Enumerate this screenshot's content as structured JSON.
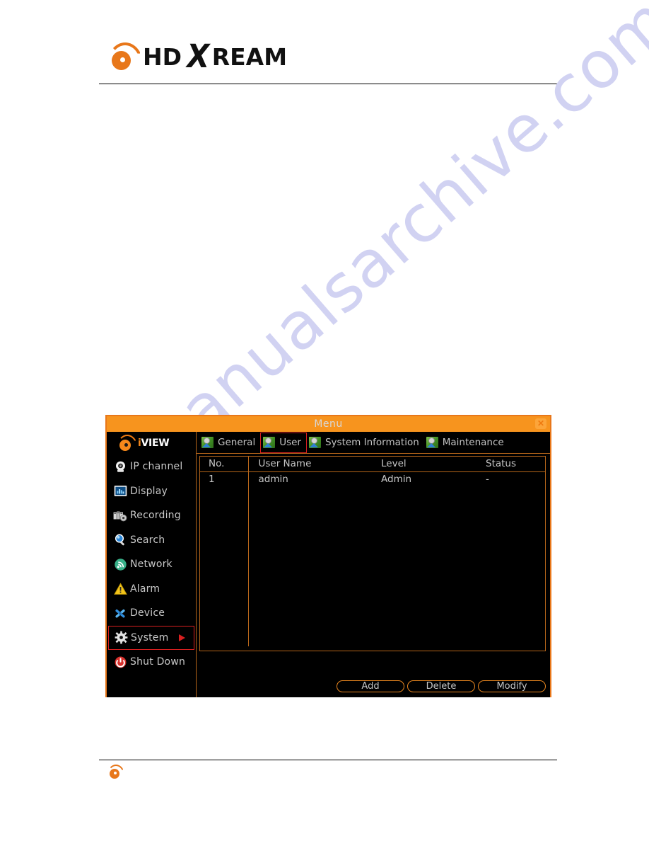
{
  "page": {
    "brand_prefix": "HD",
    "brand_x": "X",
    "brand_suffix": "REAM",
    "watermark": "manualsarchive.com"
  },
  "dialog": {
    "title": "Menu",
    "close_label": "✕",
    "brand_i": "i",
    "brand_view": "VIEW",
    "sidebar": {
      "items": [
        {
          "label": "IP channel",
          "icon": "camera-icon",
          "active": false
        },
        {
          "label": "Display",
          "icon": "picture-icon",
          "active": false
        },
        {
          "label": "Recording",
          "icon": "tape-icon",
          "active": false
        },
        {
          "label": "Search",
          "icon": "magnifier-icon",
          "active": false
        },
        {
          "label": "Network",
          "icon": "network-icon",
          "active": false
        },
        {
          "label": "Alarm",
          "icon": "warning-triangle-icon",
          "active": false
        },
        {
          "label": "Device",
          "icon": "wrench-icon",
          "active": false
        },
        {
          "label": "System",
          "icon": "gear-icon",
          "active": true
        },
        {
          "label": "Shut Down",
          "icon": "power-icon",
          "active": false
        }
      ]
    },
    "tabs": [
      {
        "label": "General",
        "active": false
      },
      {
        "label": "User",
        "active": true
      },
      {
        "label": "System Information",
        "active": false
      },
      {
        "label": "Maintenance",
        "active": false
      }
    ],
    "table": {
      "columns": [
        "No.",
        "User Name",
        "Level",
        "Status"
      ],
      "rows": [
        {
          "no": "1",
          "user_name": "admin",
          "level": "Admin",
          "status": "-"
        }
      ]
    },
    "buttons": [
      {
        "label": "Add"
      },
      {
        "label": "Delete"
      },
      {
        "label": "Modify"
      }
    ]
  },
  "colors": {
    "accent_orange": "#f7941e",
    "border_orange": "#b5651a",
    "highlight_red": "#d81f1f",
    "background_black": "#000000",
    "text_grey": "#c6c6c6",
    "watermark_blue": "#c9cbf0"
  }
}
